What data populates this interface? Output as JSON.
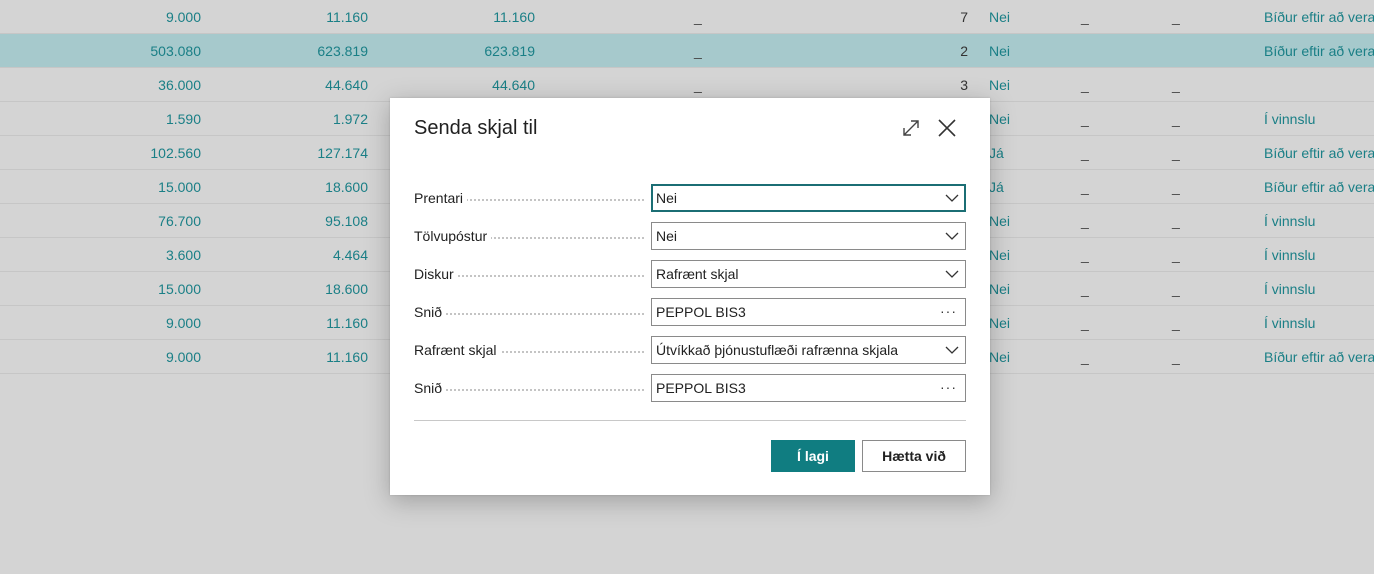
{
  "background_table": {
    "rows": [
      {
        "n1": "9.000",
        "n2": "11.160",
        "n3": "11.160",
        "d1": "_",
        "num": "7",
        "bool": "Nei",
        "d2": "_",
        "d3": "_",
        "status": "Bíður eftir að vera"
      },
      {
        "n1": "503.080",
        "n2": "623.819",
        "n3": "623.819",
        "d1": "_",
        "num": "2",
        "bool": "Nei",
        "d2": "",
        "d3": "",
        "status": "Bíður eftir að vera",
        "selected": true
      },
      {
        "n1": "36.000",
        "n2": "44.640",
        "n3": "44.640",
        "d1": "_",
        "num": "3",
        "bool": "Nei",
        "d2": "_",
        "d3": "_",
        "status": ""
      },
      {
        "n1": "1.590",
        "n2": "1.972",
        "n3": "",
        "d1": "",
        "num": "",
        "bool": "Nei",
        "d2": "_",
        "d3": "_",
        "status": "Í vinnslu"
      },
      {
        "n1": "102.560",
        "n2": "127.174",
        "n3": "",
        "d1": "",
        "num": "",
        "bool": "Já",
        "d2": "_",
        "d3": "_",
        "status": "Bíður eftir að vera"
      },
      {
        "n1": "15.000",
        "n2": "18.600",
        "n3": "",
        "d1": "",
        "num": "",
        "bool": "Já",
        "d2": "_",
        "d3": "_",
        "status": "Bíður eftir að vera"
      },
      {
        "n1": "76.700",
        "n2": "95.108",
        "n3": "",
        "d1": "",
        "num": "",
        "bool": "Nei",
        "d2": "_",
        "d3": "_",
        "status": "Í vinnslu"
      },
      {
        "n1": "3.600",
        "n2": "4.464",
        "n3": "",
        "d1": "",
        "num": "",
        "bool": "Nei",
        "d2": "_",
        "d3": "_",
        "status": "Í vinnslu"
      },
      {
        "n1": "15.000",
        "n2": "18.600",
        "n3": "",
        "d1": "",
        "num": "",
        "bool": "Nei",
        "d2": "_",
        "d3": "_",
        "status": "Í vinnslu"
      },
      {
        "n1": "9.000",
        "n2": "11.160",
        "n3": "",
        "d1": "",
        "num": "",
        "bool": "Nei",
        "d2": "_",
        "d3": "_",
        "status": "Í vinnslu"
      },
      {
        "n1": "9.000",
        "n2": "11.160",
        "n3": "",
        "d1": "",
        "num": "",
        "bool": "Nei",
        "d2": "_",
        "d3": "_",
        "status": "Bíður eftir að vera"
      }
    ]
  },
  "dialog": {
    "title": "Senda skjal til",
    "icons": {
      "expand": "expand-icon",
      "close": "close-icon"
    },
    "fields": [
      {
        "label": "Prentari",
        "value": "Nei",
        "control": "dropdown",
        "focused": true
      },
      {
        "label": "Tölvupóstur",
        "value": "Nei",
        "control": "dropdown"
      },
      {
        "label": "Diskur",
        "value": "Rafrænt skjal",
        "control": "dropdown"
      },
      {
        "label": "Snið",
        "value": "PEPPOL BIS3",
        "control": "lookup"
      },
      {
        "label": "Rafrænt skjal",
        "value": "Útvíkkað þjónustuflæði rafrænna skjala",
        "control": "dropdown"
      },
      {
        "label": "Snið",
        "value": "PEPPOL BIS3",
        "control": "lookup"
      }
    ],
    "ok_label": "Í lagi",
    "cancel_label": "Hætta við"
  },
  "colors": {
    "accent": "#107d81",
    "link_text": "#1a7f86",
    "selected_row": "#a6c9cc",
    "overlay_bg": "#d4d4d4"
  }
}
